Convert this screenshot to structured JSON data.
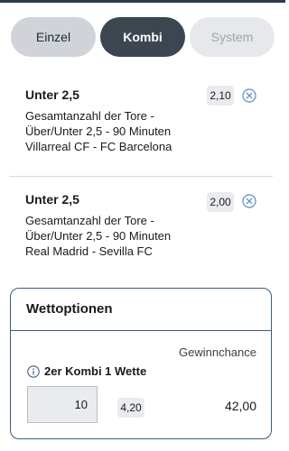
{
  "tabs": [
    {
      "label": "Einzel"
    },
    {
      "label": "Kombi"
    },
    {
      "label": "System"
    }
  ],
  "bets": [
    {
      "title": "Unter 2,5",
      "market_line1": "Gesamtanzahl der Tore -",
      "market_line2": "Über/Unter 2,5 - 90 Minuten",
      "match": "Villarreal CF - FC Barcelona",
      "odds": "2,10"
    },
    {
      "title": "Unter 2,5",
      "market_line1": "Gesamtanzahl der Tore -",
      "market_line2": "Über/Unter 2,5 - 90 Minuten",
      "match": "Real Madrid - Sevilla FC",
      "odds": "2,00"
    }
  ],
  "options": {
    "title": "Wettoptionen",
    "gewinn_label": "Gewinnchance",
    "kombi_label": "2er Kombi 1 Wette",
    "stake": "10",
    "total_odds": "4,20",
    "payout": "42,00"
  },
  "colors": {
    "tab_active": "#3c4650",
    "accent_blue": "#3d5a87",
    "icon_blue": "#5b8ac8"
  }
}
